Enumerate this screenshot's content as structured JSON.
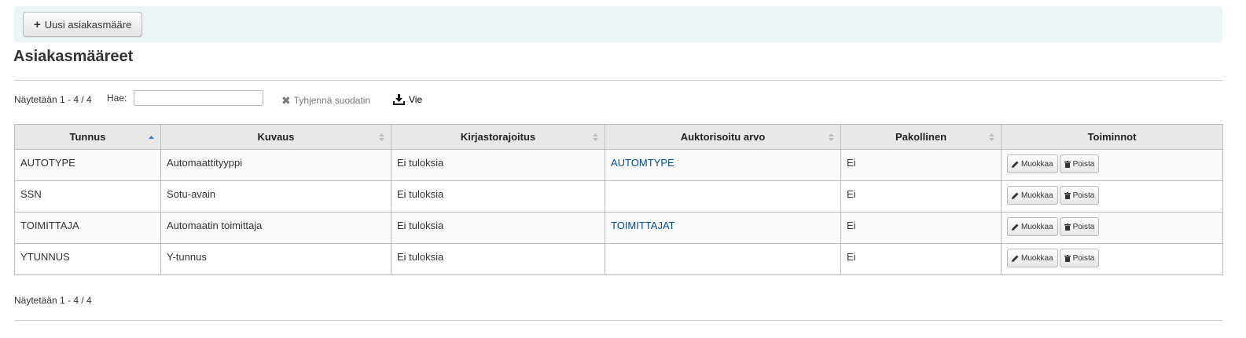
{
  "toolbar": {
    "new_button_label": "Uusi asiakasmääre"
  },
  "page": {
    "title": "Asiakasmääreet"
  },
  "filter": {
    "info_top": "Näytetään 1 - 4 / 4",
    "info_bottom": "Näytetään 1 - 4 / 4",
    "search_label": "Hae:",
    "search_value": "",
    "clear_label": "Tyhjennä suodatin",
    "export_label": "Vie"
  },
  "table": {
    "headers": [
      "Tunnus",
      "Kuvaus",
      "Kirjastorajoitus",
      "Auktorisoitu arvo",
      "Pakollinen",
      "Toiminnot"
    ],
    "edit_label": "Muokkaa",
    "delete_label": "Poista",
    "rows": [
      {
        "code": "AUTOTYPE",
        "description": "Automaattityyppi",
        "library_limit": "Ei tuloksia",
        "authorised_value": "AUTOMTYPE",
        "mandatory": "Ei"
      },
      {
        "code": "SSN",
        "description": "Sotu-avain",
        "library_limit": "Ei tuloksia",
        "authorised_value": "",
        "mandatory": "Ei"
      },
      {
        "code": "TOIMITTAJA",
        "description": "Automaatin toimittaja",
        "library_limit": "Ei tuloksia",
        "authorised_value": "TOIMITTAJAT",
        "mandatory": "Ei"
      },
      {
        "code": "YTUNNUS",
        "description": "Y-tunnus",
        "library_limit": "Ei tuloksia",
        "authorised_value": "",
        "mandatory": "Ei"
      }
    ]
  },
  "colors": {
    "link": "#004d99",
    "toolbar_bg": "#edf4f6",
    "sort_active": "#3a7bd5"
  },
  "icons": {
    "new": "plus-icon",
    "clear": "x-icon",
    "export": "download-icon",
    "edit": "pencil-icon",
    "delete": "trash-icon"
  }
}
